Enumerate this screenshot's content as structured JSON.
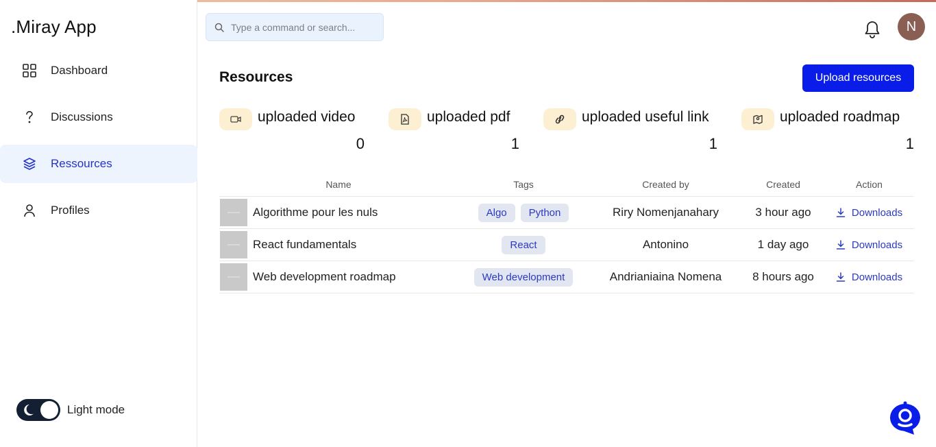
{
  "app": {
    "brand": ".Miray App"
  },
  "sidebar": {
    "items": [
      {
        "label": "Dashboard",
        "icon": "grid-icon",
        "active": false
      },
      {
        "label": "Discussions",
        "icon": "question-icon",
        "active": false
      },
      {
        "label": "Ressources",
        "icon": "layers-icon",
        "active": true
      },
      {
        "label": "Profiles",
        "icon": "user-icon",
        "active": false
      }
    ],
    "theme_label": "Light mode"
  },
  "header": {
    "search_placeholder": "Type a command or search...",
    "avatar_initial": "N"
  },
  "main": {
    "title": "Resources",
    "upload_label": "Upload resources",
    "stats": [
      {
        "label": "uploaded video",
        "value": "0",
        "icon": "video-icon"
      },
      {
        "label": "uploaded pdf",
        "value": "1",
        "icon": "pdf-file-icon"
      },
      {
        "label": "uploaded useful link",
        "value": "1",
        "icon": "link-icon"
      },
      {
        "label": "uploaded roadmap",
        "value": "1",
        "icon": "map-icon"
      }
    ],
    "table": {
      "headers": [
        "Name",
        "Tags",
        "Created by",
        "Created",
        "Action"
      ],
      "rows": [
        {
          "name": "Algorithme pour les nuls",
          "tags": [
            "Algo",
            "Python"
          ],
          "created_by": "Riry Nomenjanahary",
          "created": "3 hour ago",
          "action": "Downloads"
        },
        {
          "name": "React fundamentals",
          "tags": [
            "React"
          ],
          "created_by": "Antonino",
          "created": "1 day ago",
          "action": "Downloads"
        },
        {
          "name": "Web development roadmap",
          "tags": [
            "Web development"
          ],
          "created_by": "Andrianiaina Nomena",
          "created": "8 hours ago",
          "action": "Downloads"
        }
      ]
    }
  },
  "colors": {
    "accent": "#0a1de8",
    "link": "#2a39c4",
    "badge_bg": "#fdefd1",
    "active_bg": "#eef4fd"
  }
}
